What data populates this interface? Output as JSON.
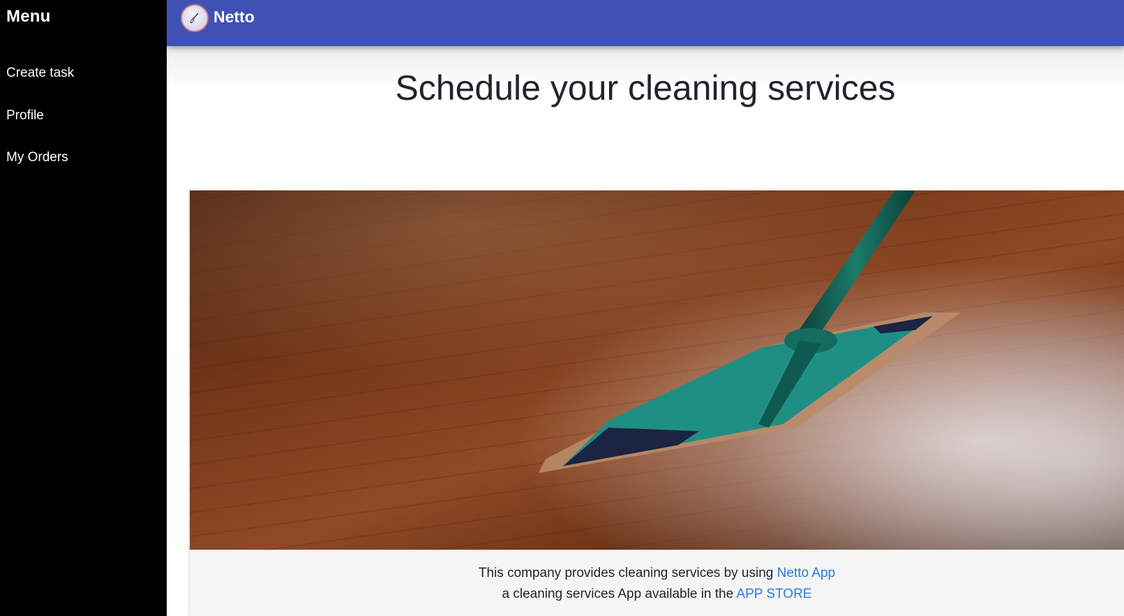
{
  "sidebar": {
    "title": "Menu",
    "items": [
      {
        "label": "Create task"
      },
      {
        "label": "Profile"
      },
      {
        "label": "My Orders"
      }
    ]
  },
  "header": {
    "brand": "Netto",
    "logo_icon": "broom-logo-icon",
    "background_color": "#3f51b5"
  },
  "main": {
    "title": "Schedule your cleaning services",
    "hero_image": "mop-on-wooden-floor-photo",
    "caption": {
      "line1_text": "This company provides cleaning services by using ",
      "line1_link": "Netto App",
      "line2_text": "a cleaning services App available in the ",
      "line2_link": "APP STORE"
    }
  },
  "colors": {
    "sidebar_bg": "#000000",
    "link": "#2a7ae2",
    "heading": "#212529"
  }
}
